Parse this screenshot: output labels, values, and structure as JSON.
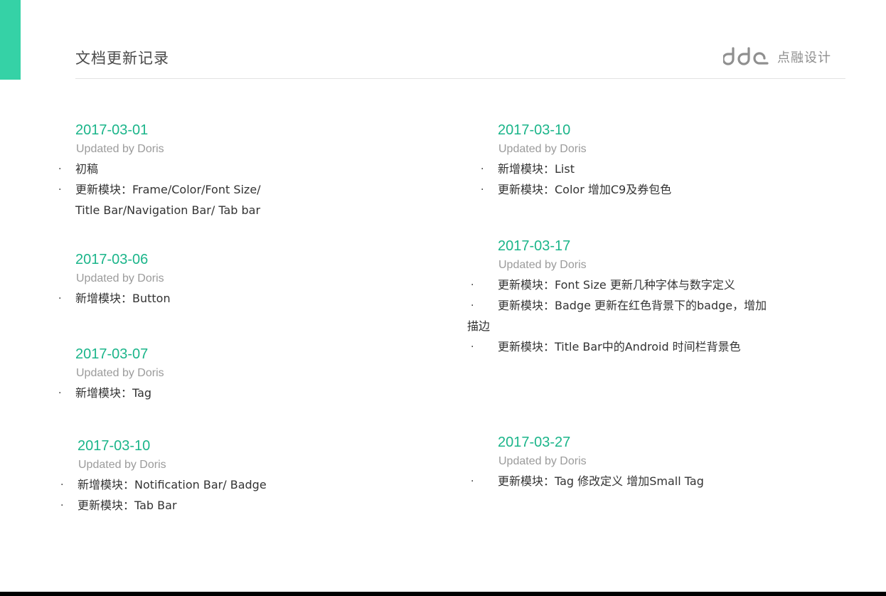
{
  "header": {
    "title": "文档更新记录",
    "logo_mark": "ddc",
    "logo_text": "点融设计",
    "accent_color": "#35d2a6"
  },
  "bullet_char": "·",
  "changelog": {
    "left": [
      {
        "date": "2017-03-01",
        "author": "Updated by Doris",
        "items": [
          [
            "初稿"
          ],
          [
            "更新模块：Frame/Color/Font Size/",
            "Title Bar/Navigation Bar/ Tab bar"
          ]
        ]
      },
      {
        "date": "2017-03-06",
        "author": "Updated by Doris",
        "items": [
          [
            "新增模块：Button"
          ]
        ]
      },
      {
        "date": "2017-03-07",
        "author": "Updated by Doris",
        "items": [
          [
            "新增模块：Tag"
          ]
        ]
      },
      {
        "date": "2017-03-10",
        "author": "Updated by Doris",
        "items": [
          [
            "新增模块：Notification Bar/ Badge"
          ],
          [
            "更新模块：Tab Bar"
          ]
        ]
      }
    ],
    "right": [
      {
        "date": "2017-03-10",
        "author": "Updated by Doris",
        "items": [
          [
            "新增模块：List"
          ],
          [
            "更新模块：Color 增加C9及券包色"
          ]
        ]
      },
      {
        "date": "2017-03-17",
        "author": "Updated by Doris",
        "items": [
          [
            "更新模块：Font Size 更新几种字体与数字定义"
          ],
          [
            "更新模块：Badge 更新在红色背景下的badge，增加",
            "描边"
          ],
          [
            "更新模块：Title Bar中的Android 时间栏背景色"
          ]
        ]
      },
      {
        "date": "2017-03-27",
        "author": "Updated by Doris",
        "items": [
          [
            "更新模块：Tag 修改定义 增加Small Tag"
          ]
        ]
      }
    ]
  }
}
